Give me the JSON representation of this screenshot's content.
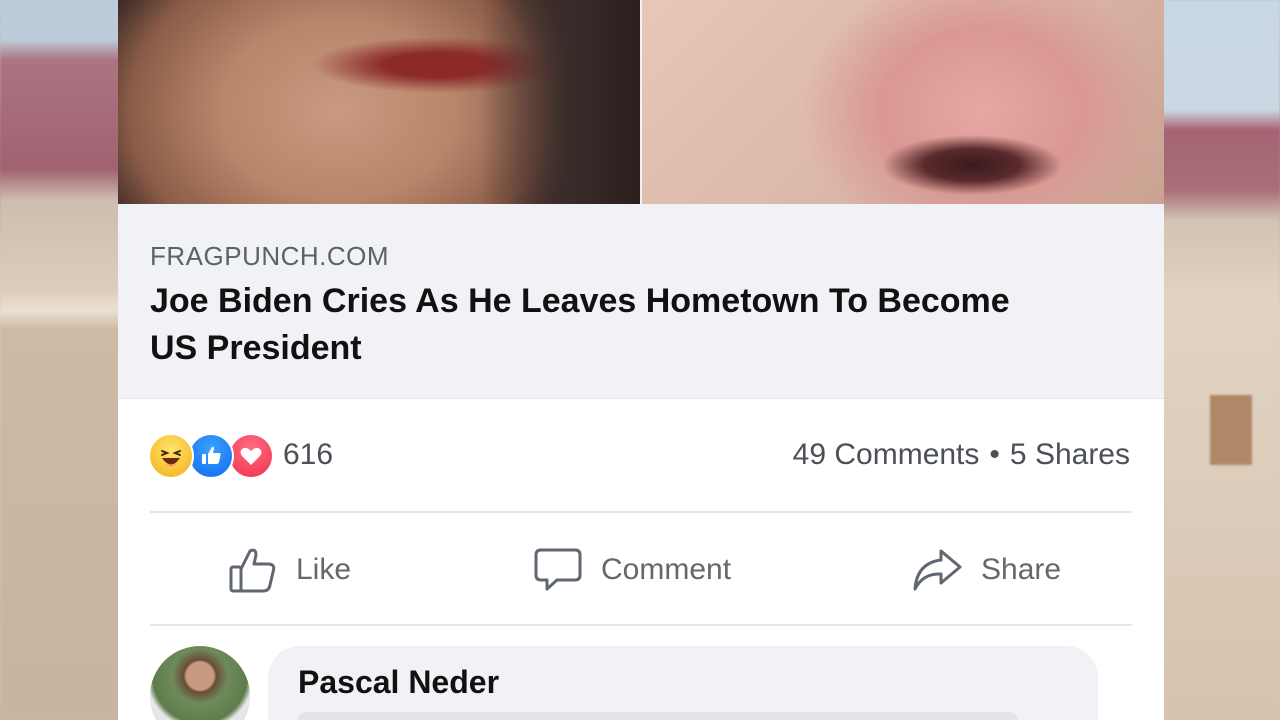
{
  "post": {
    "link": {
      "domain": "FRAGPUNCH.COM",
      "headline": "Joe Biden Cries As He Leaves Hometown To Become US President"
    },
    "stats": {
      "reactions": [
        "haha-icon",
        "like-icon",
        "love-icon"
      ],
      "reaction_count": "616",
      "comments": "49 Comments",
      "separator": "•",
      "shares": "5 Shares"
    },
    "actions": {
      "like_label": "Like",
      "comment_label": "Comment",
      "share_label": "Share"
    },
    "first_comment": {
      "author": "Pascal Neder"
    }
  },
  "colors": {
    "card_bg": "#ffffff",
    "link_box_bg": "#f0f2f5",
    "text_secondary": "#65676b",
    "like_blue": "#1877f2",
    "love_red": "#f33e58",
    "haha_yellow": "#f7b928"
  }
}
